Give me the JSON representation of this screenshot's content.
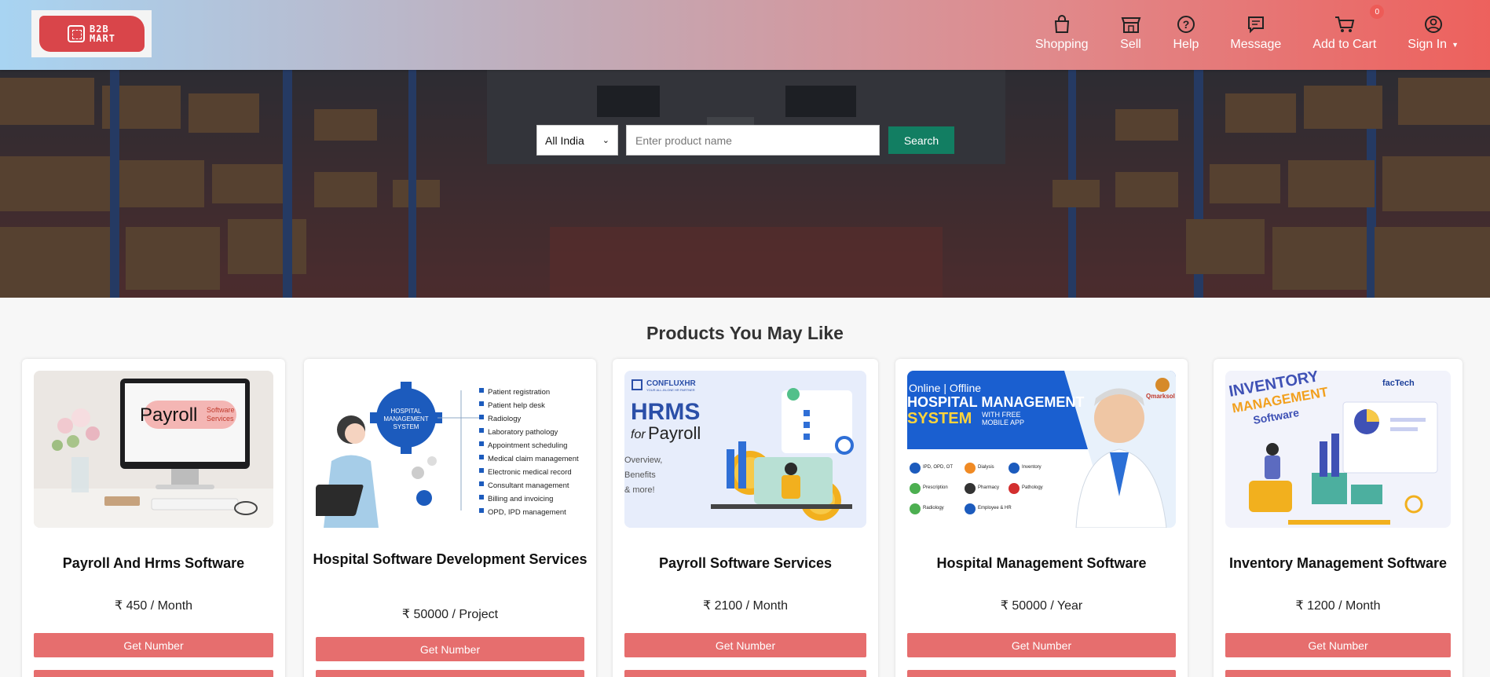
{
  "header": {
    "logo_text_line1": "B2B",
    "logo_text_line2": "MART",
    "nav": [
      {
        "label": "Shopping",
        "icon": "shopping-bag-icon"
      },
      {
        "label": "Sell",
        "icon": "store-icon"
      },
      {
        "label": "Help",
        "icon": "help-icon"
      },
      {
        "label": "Message",
        "icon": "message-icon"
      },
      {
        "label": "Add to Cart",
        "icon": "cart-icon",
        "badge": "0"
      },
      {
        "label": "Sign In",
        "icon": "user-icon"
      }
    ]
  },
  "search": {
    "location": "All India",
    "placeholder": "Enter product name",
    "button": "Search"
  },
  "section_title": "Products You May Like",
  "products": [
    {
      "title": "Payroll And Hrms Software",
      "price": "₹ 450 / Month",
      "cta": "Get Number",
      "image_text": {
        "main": "Payroll",
        "sub1": "Software",
        "sub2": "Services"
      }
    },
    {
      "title": "Hospital Software Development Services",
      "price": "₹ 50000 / Project",
      "cta": "Get Number",
      "image_text": {
        "hub1": "HOSPITAL",
        "hub2": "MANAGEMENT",
        "hub3": "SYSTEM",
        "features": [
          "Patient registration",
          "Patient help desk",
          "Radiology",
          "Laboratory pathology",
          "Appointment scheduling",
          "Medical claim management",
          "Electronic medical record",
          "Consultant management",
          "Billing and invoicing",
          "OPD, IPD management"
        ]
      }
    },
    {
      "title": "Payroll Software Services",
      "price": "₹ 2100 / Month",
      "cta": "Get Number",
      "image_text": {
        "brand": "CONFLUXHR",
        "brand_sub": "YOUR ALL-IN-ONE HR PARTNER",
        "title": "HRMS",
        "for": "for",
        "payroll": "Payroll",
        "bullets": [
          "Overview,",
          "Benefits",
          "& more!"
        ]
      }
    },
    {
      "title": "Hospital Management Software",
      "price": "₹ 50000 / Year",
      "cta": "Get Number",
      "image_text": {
        "top": "Online | Offline",
        "line1": "HOSPITAL MANAGEMENT",
        "line2": "SYSTEM",
        "with": "WITH FREE",
        "app": "MOBILE APP",
        "brand": "Qmarksol",
        "features": [
          "IPD, OPD, OT",
          "Dialysis",
          "Inventory",
          "Prescription",
          "Pharmacy",
          "Pathology",
          "Radiology",
          "Employee & HR"
        ]
      }
    },
    {
      "title": "Inventory Management Software",
      "price": "₹ 1200 / Month",
      "cta": "Get Number",
      "image_text": {
        "line1": "INVENTORY",
        "line2": "MANAGEMENT",
        "line3": "Software",
        "brand": "facTech"
      }
    }
  ],
  "colors": {
    "accent": "#e66e6e",
    "search_button": "#127e62"
  }
}
